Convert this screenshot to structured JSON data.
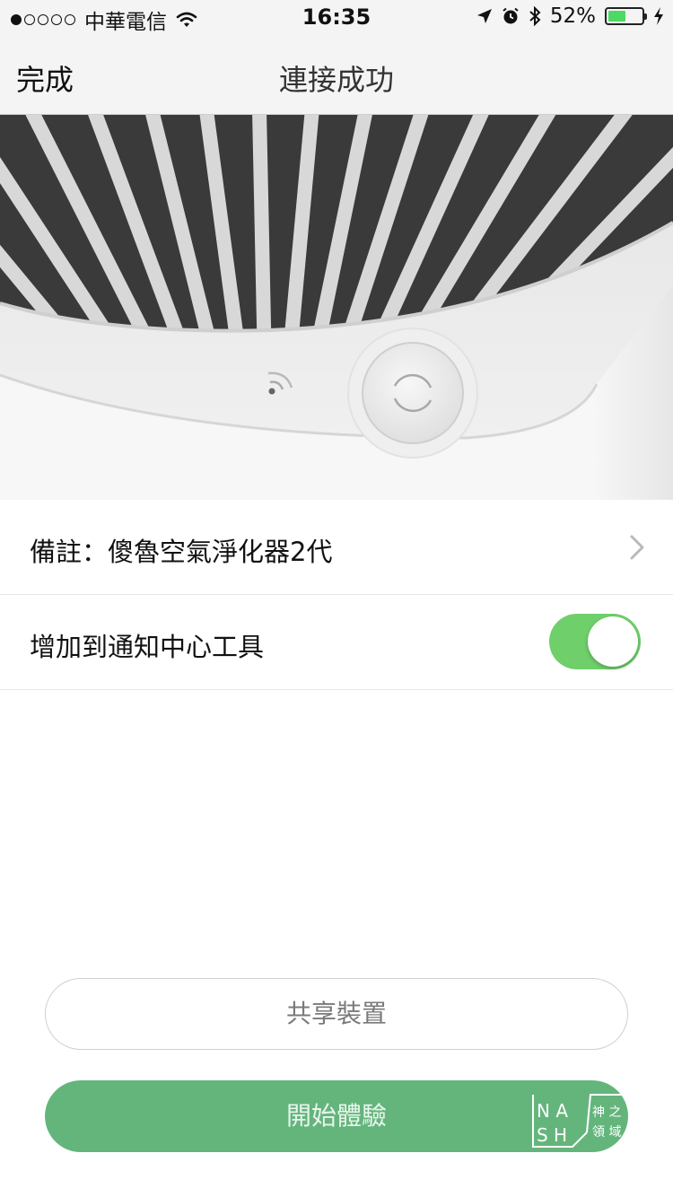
{
  "status_bar": {
    "carrier": "中華電信",
    "time": "16:35",
    "battery_percent": "52%",
    "battery_level": 0.52,
    "signal_dots_filled": 1,
    "signal_dots_total": 5,
    "icons": [
      "signal-dots-icon",
      "wifi-icon",
      "location-arrow-icon",
      "alarm-icon",
      "bluetooth-icon",
      "battery-icon",
      "charging-bolt-icon"
    ]
  },
  "nav": {
    "done_label": "完成",
    "title": "連接成功"
  },
  "settings": {
    "note_label": "備註：傻魯空氣淨化器2代",
    "notification_label": "增加到通知中心工具",
    "notification_enabled": true
  },
  "buttons": {
    "share_label": "共享裝置",
    "start_label": "開始體驗"
  },
  "watermark": {
    "letters": "NASH",
    "characters": "神之領域"
  },
  "colors": {
    "accent_green": "#64b57c",
    "toggle_green": "#6fcf6a",
    "battery_green": "#4cd964"
  }
}
